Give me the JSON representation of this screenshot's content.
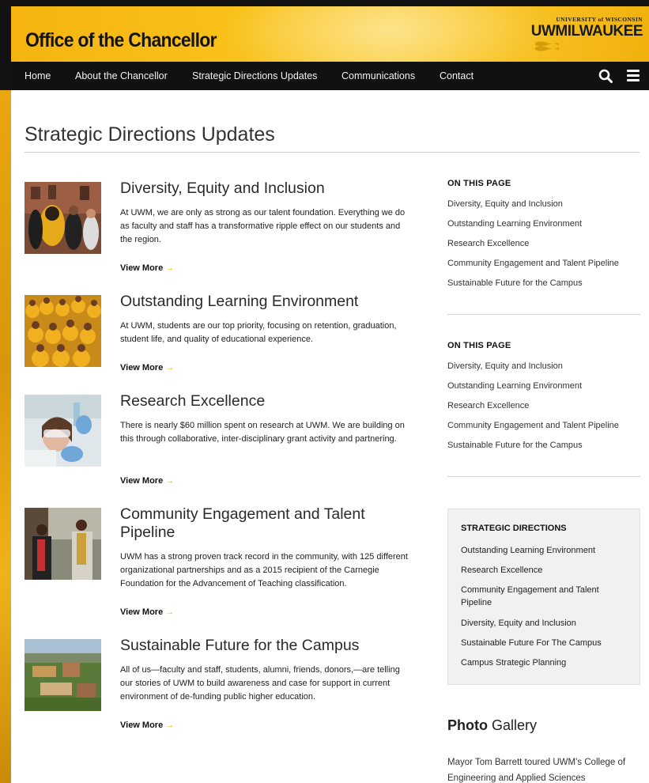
{
  "header": {
    "site_title": "Office of the Chancellor",
    "logo_small": "UNIVERSITY of WISCONSIN",
    "logo_big": "UWMILWAUKEE"
  },
  "nav": {
    "items": [
      "Home",
      "About the Chancellor",
      "Strategic Directions Updates",
      "Communications",
      "Contact"
    ],
    "search_icon": "search-icon",
    "menu_icon": "hamburger-menu-icon"
  },
  "main": {
    "page_title": "Strategic Directions Updates",
    "items": [
      {
        "title": "Diversity, Equity and Inclusion",
        "text": "At UWM, we are only as strong as our talent foundation. Everything we do as faculty and staff has a transformative ripple effect on our students and the region.",
        "more": "View More"
      },
      {
        "title": "Outstanding Learning Environment",
        "text": "At UWM, students are our top priority, focusing on retention, graduation, student life, and quality of educational experience.",
        "more": "View More"
      },
      {
        "title": "Research Excellence",
        "text": "There is nearly $60 million spent on research at UWM. We are building on this through collaborative, inter-disciplinary grant activity and partnering.",
        "more": "View More"
      },
      {
        "title": "Community Engagement and Talent Pipeline",
        "text": "UWM has a strong proven track record in the community, with 125 different organizational partnerships and as a 2015 recipient of the Carnegie Foundation for the Advancement of Teaching classification.",
        "more": "View More"
      },
      {
        "title": "Sustainable Future for the Campus",
        "text": "All of us—faculty and staff, students, alumni, friends, donors,—are telling our stories of UWM to build awareness and case for support in current environment of de-funding public higher education.",
        "more": "View More"
      }
    ],
    "more_arrow": "→"
  },
  "sidebar": {
    "on_this_page_1": {
      "heading": "ON THIS PAGE",
      "links": [
        "Diversity, Equity and Inclusion",
        "Outstanding Learning Environment",
        "Research Excellence",
        "Community Engagement and Talent Pipeline",
        "Sustainable Future for the Campus"
      ]
    },
    "on_this_page_2": {
      "heading": "ON THIS PAGE",
      "links": [
        "Diversity, Equity and Inclusion",
        "Outstanding Learning Environment",
        "Research Excellence",
        "Community Engagement and Talent Pipeline",
        "Sustainable Future for the Campus"
      ]
    },
    "strategic": {
      "heading": "STRATEGIC DIRECTIONS",
      "links": [
        "Outstanding Learning Environment",
        "Research Excellence",
        "Community Engagement and Talent Pipeline",
        "Diversity, Equity and Inclusion",
        "Sustainable Future For The Campus",
        "Campus Strategic Planning"
      ]
    },
    "gallery": {
      "title_bold": "Photo",
      "title_rest": " Gallery",
      "text": "Mayor Tom Barrett toured UWM's College of Engineering and Applied Sciences"
    }
  },
  "colors": {
    "gold": "#f5b40f",
    "nav_bg": "#111111",
    "arrow": "#f3b10f"
  }
}
